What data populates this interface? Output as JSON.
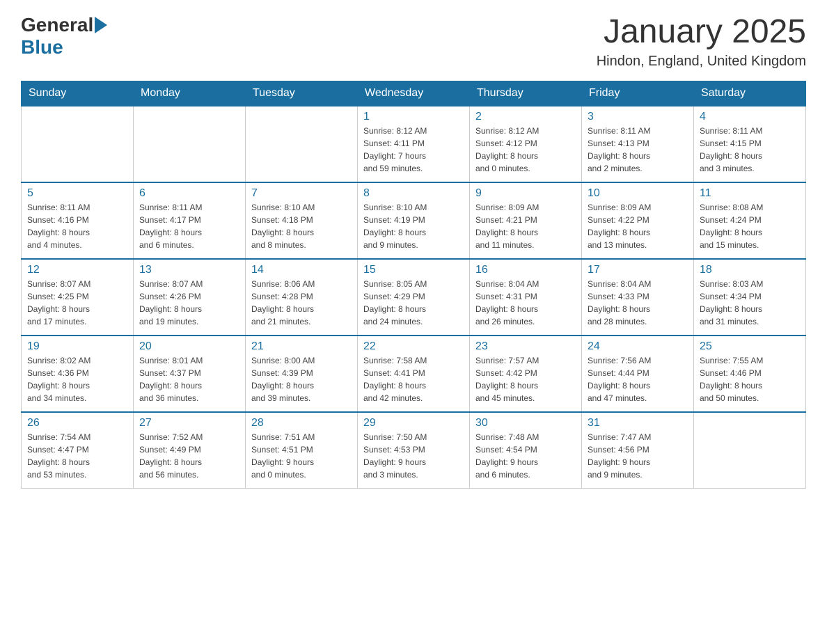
{
  "header": {
    "logo_general": "General",
    "logo_blue": "Blue",
    "month_title": "January 2025",
    "location": "Hindon, England, United Kingdom"
  },
  "columns": [
    "Sunday",
    "Monday",
    "Tuesday",
    "Wednesday",
    "Thursday",
    "Friday",
    "Saturday"
  ],
  "weeks": [
    [
      {
        "day": "",
        "info": ""
      },
      {
        "day": "",
        "info": ""
      },
      {
        "day": "",
        "info": ""
      },
      {
        "day": "1",
        "info": "Sunrise: 8:12 AM\nSunset: 4:11 PM\nDaylight: 7 hours\nand 59 minutes."
      },
      {
        "day": "2",
        "info": "Sunrise: 8:12 AM\nSunset: 4:12 PM\nDaylight: 8 hours\nand 0 minutes."
      },
      {
        "day": "3",
        "info": "Sunrise: 8:11 AM\nSunset: 4:13 PM\nDaylight: 8 hours\nand 2 minutes."
      },
      {
        "day": "4",
        "info": "Sunrise: 8:11 AM\nSunset: 4:15 PM\nDaylight: 8 hours\nand 3 minutes."
      }
    ],
    [
      {
        "day": "5",
        "info": "Sunrise: 8:11 AM\nSunset: 4:16 PM\nDaylight: 8 hours\nand 4 minutes."
      },
      {
        "day": "6",
        "info": "Sunrise: 8:11 AM\nSunset: 4:17 PM\nDaylight: 8 hours\nand 6 minutes."
      },
      {
        "day": "7",
        "info": "Sunrise: 8:10 AM\nSunset: 4:18 PM\nDaylight: 8 hours\nand 8 minutes."
      },
      {
        "day": "8",
        "info": "Sunrise: 8:10 AM\nSunset: 4:19 PM\nDaylight: 8 hours\nand 9 minutes."
      },
      {
        "day": "9",
        "info": "Sunrise: 8:09 AM\nSunset: 4:21 PM\nDaylight: 8 hours\nand 11 minutes."
      },
      {
        "day": "10",
        "info": "Sunrise: 8:09 AM\nSunset: 4:22 PM\nDaylight: 8 hours\nand 13 minutes."
      },
      {
        "day": "11",
        "info": "Sunrise: 8:08 AM\nSunset: 4:24 PM\nDaylight: 8 hours\nand 15 minutes."
      }
    ],
    [
      {
        "day": "12",
        "info": "Sunrise: 8:07 AM\nSunset: 4:25 PM\nDaylight: 8 hours\nand 17 minutes."
      },
      {
        "day": "13",
        "info": "Sunrise: 8:07 AM\nSunset: 4:26 PM\nDaylight: 8 hours\nand 19 minutes."
      },
      {
        "day": "14",
        "info": "Sunrise: 8:06 AM\nSunset: 4:28 PM\nDaylight: 8 hours\nand 21 minutes."
      },
      {
        "day": "15",
        "info": "Sunrise: 8:05 AM\nSunset: 4:29 PM\nDaylight: 8 hours\nand 24 minutes."
      },
      {
        "day": "16",
        "info": "Sunrise: 8:04 AM\nSunset: 4:31 PM\nDaylight: 8 hours\nand 26 minutes."
      },
      {
        "day": "17",
        "info": "Sunrise: 8:04 AM\nSunset: 4:33 PM\nDaylight: 8 hours\nand 28 minutes."
      },
      {
        "day": "18",
        "info": "Sunrise: 8:03 AM\nSunset: 4:34 PM\nDaylight: 8 hours\nand 31 minutes."
      }
    ],
    [
      {
        "day": "19",
        "info": "Sunrise: 8:02 AM\nSunset: 4:36 PM\nDaylight: 8 hours\nand 34 minutes."
      },
      {
        "day": "20",
        "info": "Sunrise: 8:01 AM\nSunset: 4:37 PM\nDaylight: 8 hours\nand 36 minutes."
      },
      {
        "day": "21",
        "info": "Sunrise: 8:00 AM\nSunset: 4:39 PM\nDaylight: 8 hours\nand 39 minutes."
      },
      {
        "day": "22",
        "info": "Sunrise: 7:58 AM\nSunset: 4:41 PM\nDaylight: 8 hours\nand 42 minutes."
      },
      {
        "day": "23",
        "info": "Sunrise: 7:57 AM\nSunset: 4:42 PM\nDaylight: 8 hours\nand 45 minutes."
      },
      {
        "day": "24",
        "info": "Sunrise: 7:56 AM\nSunset: 4:44 PM\nDaylight: 8 hours\nand 47 minutes."
      },
      {
        "day": "25",
        "info": "Sunrise: 7:55 AM\nSunset: 4:46 PM\nDaylight: 8 hours\nand 50 minutes."
      }
    ],
    [
      {
        "day": "26",
        "info": "Sunrise: 7:54 AM\nSunset: 4:47 PM\nDaylight: 8 hours\nand 53 minutes."
      },
      {
        "day": "27",
        "info": "Sunrise: 7:52 AM\nSunset: 4:49 PM\nDaylight: 8 hours\nand 56 minutes."
      },
      {
        "day": "28",
        "info": "Sunrise: 7:51 AM\nSunset: 4:51 PM\nDaylight: 9 hours\nand 0 minutes."
      },
      {
        "day": "29",
        "info": "Sunrise: 7:50 AM\nSunset: 4:53 PM\nDaylight: 9 hours\nand 3 minutes."
      },
      {
        "day": "30",
        "info": "Sunrise: 7:48 AM\nSunset: 4:54 PM\nDaylight: 9 hours\nand 6 minutes."
      },
      {
        "day": "31",
        "info": "Sunrise: 7:47 AM\nSunset: 4:56 PM\nDaylight: 9 hours\nand 9 minutes."
      },
      {
        "day": "",
        "info": ""
      }
    ]
  ]
}
